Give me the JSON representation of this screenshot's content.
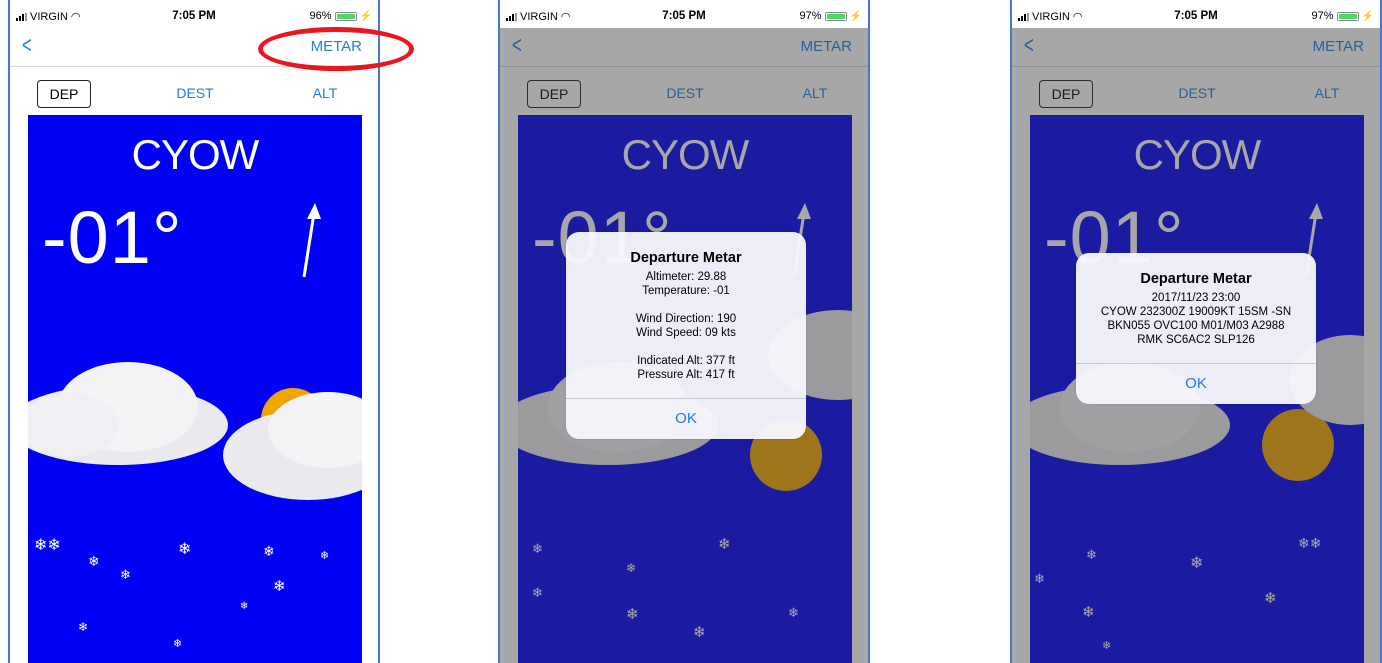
{
  "status_bar": {
    "carrier": "VIRGIN",
    "time": "7:05 PM",
    "battery_screen1": "96%",
    "battery_screen2": "97%",
    "battery_screen3": "97%"
  },
  "nav": {
    "back_glyph": "<",
    "metar_label": "METAR"
  },
  "segments": {
    "dep": "DEP",
    "dest": "DEST",
    "alt": "ALT",
    "selected": "DEP"
  },
  "weather": {
    "station": "CYOW",
    "temperature": "-01°",
    "wind_direction_deg": 190,
    "background_color": "#0000f5",
    "conditions_icons": [
      "cloud-icon",
      "sun-icon",
      "snowflake-icon"
    ]
  },
  "dialog_summary": {
    "title": "Departure Metar",
    "lines": "Altimeter: 29.88\nTemperature: -01\n\nWind Direction: 190\nWind Speed: 09 kts\n\nIndicated Alt: 377 ft\nPressure Alt: 417 ft",
    "ok": "OK"
  },
  "dialog_raw": {
    "title": "Departure Metar",
    "lines": "2017/11/23 23:00\nCYOW 232300Z 19009KT 15SM -SN\nBKN055 OVC100 M01/M03 A2988\nRMK SC6AC2 SLP126",
    "ok": "OK"
  },
  "colors": {
    "accent": "#1e7ce8",
    "highlight_ring": "#e8171e"
  }
}
